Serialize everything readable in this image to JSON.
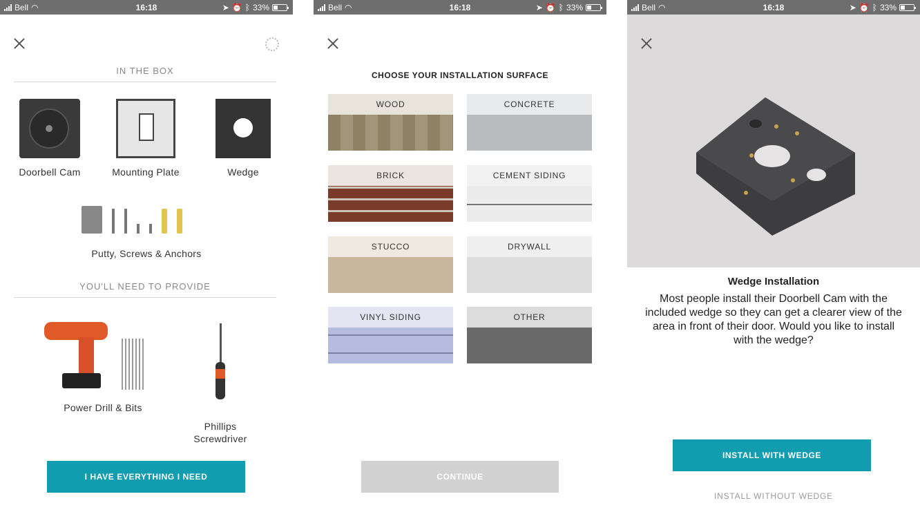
{
  "status_bar": {
    "carrier": "Bell",
    "time": "16:18",
    "battery": "33%"
  },
  "screen1": {
    "section_in_box": "IN THE BOX",
    "items": [
      "Doorbell Cam",
      "Mounting Plate",
      "Wedge"
    ],
    "hardware_label": "Putty, Screws & Anchors",
    "section_provide": "YOU'LL NEED TO PROVIDE",
    "tools": [
      "Power Drill & Bits",
      "Phillips\nScrewdriver"
    ],
    "button": "I HAVE EVERYTHING I NEED"
  },
  "screen2": {
    "title": "CHOOSE YOUR INSTALLATION SURFACE",
    "surfaces": [
      "WOOD",
      "CONCRETE",
      "BRICK",
      "CEMENT SIDING",
      "STUCCO",
      "DRYWALL",
      "VINYL SIDING",
      "OTHER"
    ],
    "button": "CONTINUE"
  },
  "screen3": {
    "title": "Wedge Installation",
    "description": "Most people install their Doorbell Cam with the included wedge so they can get a clearer view of the area in front of their door. Would you like to install with the wedge?",
    "primary_button": "INSTALL WITH WEDGE",
    "secondary_link": "INSTALL WITHOUT WEDGE"
  },
  "colors": {
    "accent": "#119cb0",
    "disabled": "#d2d2d2",
    "status_bar": "#6e6e6e"
  }
}
